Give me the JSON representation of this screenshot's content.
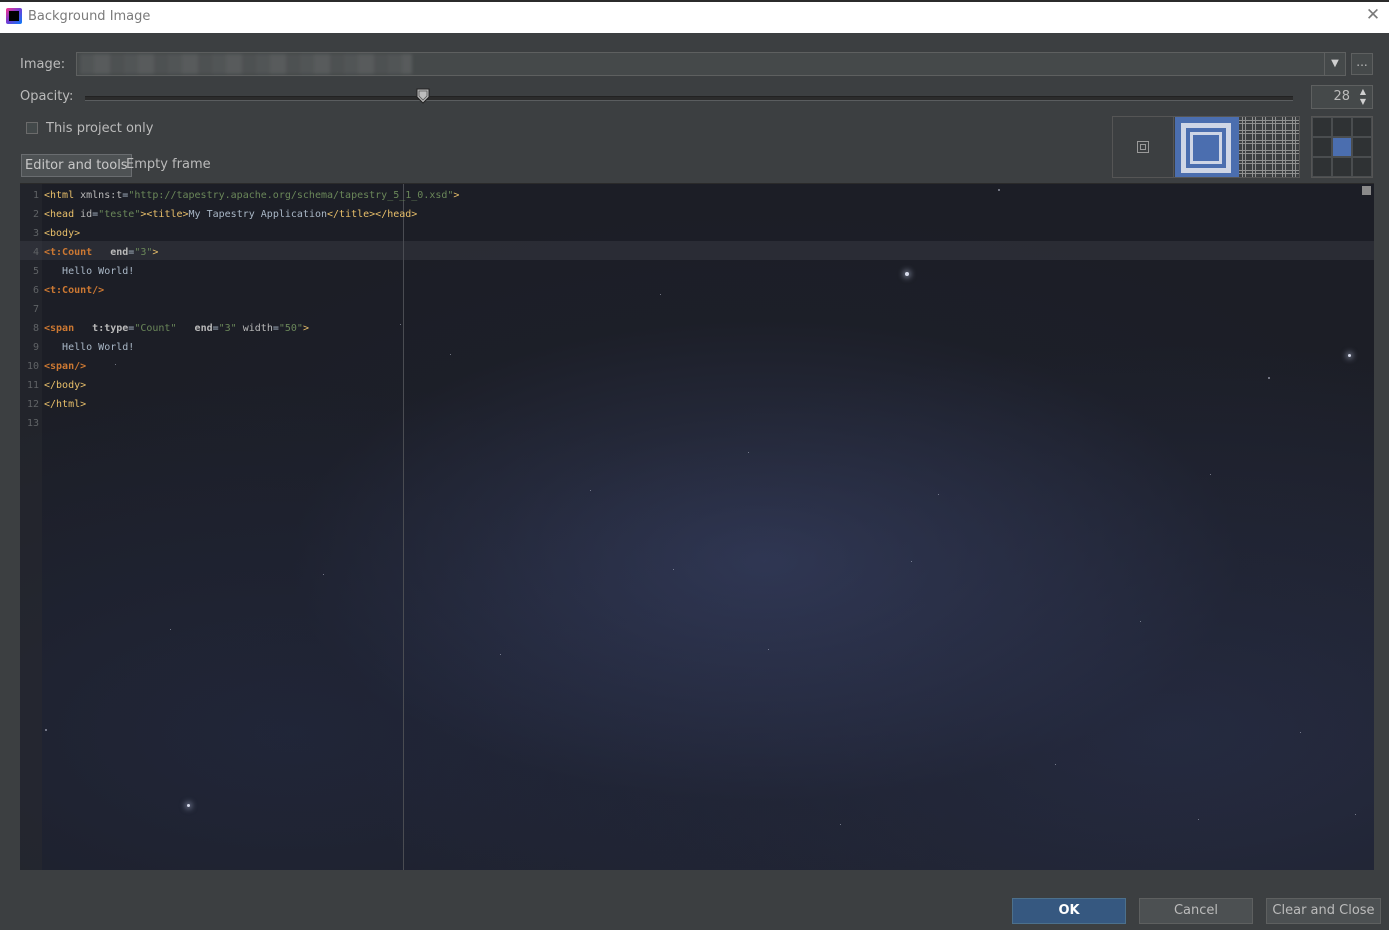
{
  "window": {
    "title": "Background Image"
  },
  "form": {
    "image_label": "Image:",
    "browse_label": "...",
    "opacity_label": "Opacity:",
    "opacity_value": "28",
    "opacity_fraction": 0.28,
    "this_project_only": "This project only",
    "this_project_only_checked": false
  },
  "tabs": [
    {
      "label": "Editor and tools",
      "active": true
    },
    {
      "label": "Empty frame",
      "active": false
    }
  ],
  "fill_options": [
    "center",
    "scale",
    "tile"
  ],
  "fill_selected": "scale",
  "anchor_selected": "center",
  "editor": {
    "lines": [
      {
        "n": "1",
        "t": "<html xmlns:t=\"http://tapestry.apache.org/schema/tapestry_5_1_0.xsd\">"
      },
      {
        "n": "2",
        "t": "<head id=\"teste\"><title>My Tapestry Application</title></head>"
      },
      {
        "n": "3",
        "t": "<body>"
      },
      {
        "n": "4",
        "t": "<t:Count   end=\"3\">"
      },
      {
        "n": "5",
        "t": "   Hello World!"
      },
      {
        "n": "6",
        "t": "<t:Count/>"
      },
      {
        "n": "7",
        "t": ""
      },
      {
        "n": "8",
        "t": "<span   t:type=\"Count\"   end=\"3\" width=\"50\">"
      },
      {
        "n": "9",
        "t": "   Hello World!"
      },
      {
        "n": "10",
        "t": "<span/>"
      },
      {
        "n": "11",
        "t": "</body>"
      },
      {
        "n": "12",
        "t": "</html>"
      },
      {
        "n": "13",
        "t": ""
      }
    ]
  },
  "buttons": {
    "ok": "OK",
    "cancel": "Cancel",
    "clear_close": "Clear and Close"
  },
  "colors": {
    "accent": "#365880",
    "selection": "#4b6eaf",
    "background": "#3c3f41"
  }
}
